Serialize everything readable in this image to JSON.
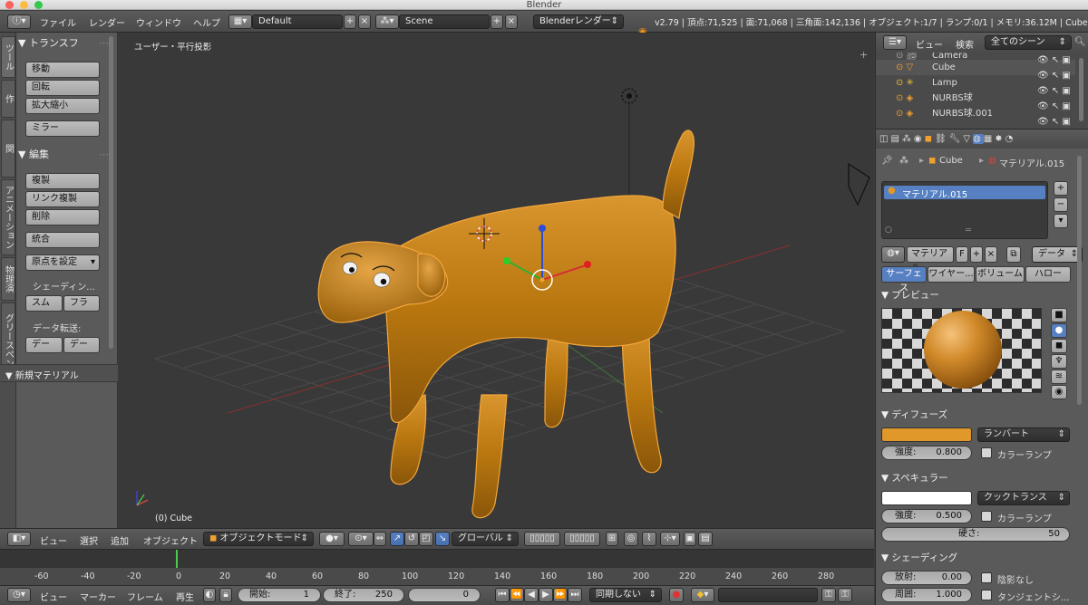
{
  "window": {
    "title": "Blender"
  },
  "info_bar": {
    "menus": [
      "ファイル",
      "レンダー",
      "ウィンドウ",
      "ヘルプ"
    ],
    "layout": "Default",
    "scene": "Scene",
    "engine": "Blenderレンダー",
    "stats": "v2.79 | 頂点:71,525 | 面:71,068 | 三角面:142,136 | オブジェクト:1/7 | ランプ:0/1 | メモリ:36.12M | Cube"
  },
  "tool_shelf": {
    "tabs": [
      "ツール",
      "作",
      "関",
      "アニメーション",
      "物理演",
      "グリースペン"
    ],
    "transform": {
      "header": "トランスフ",
      "buttons": [
        "移動",
        "回転",
        "拡大縮小",
        "ミラー"
      ]
    },
    "edit": {
      "header": "編集",
      "buttons": [
        "複製",
        "リンク複製",
        "削除",
        "統合"
      ],
      "origin": "原点を設定"
    },
    "shading": {
      "label": "シェーディン...",
      "smooth": "スム",
      "flat": "フラ"
    },
    "data_transfer": {
      "label": "データ転送:",
      "btn1": "デー",
      "btn2": "デー"
    },
    "operator": "新規マテリアル"
  },
  "viewport": {
    "view_label": "ユーザー・平行投影",
    "object_label": "(0) Cube",
    "body_color": "#c9851a"
  },
  "view3d_header": {
    "menus": [
      "ビュー",
      "選択",
      "追加",
      "オブジェクト"
    ],
    "mode": "オブジェクトモード",
    "orientation": "グローバル"
  },
  "timeline": {
    "ticks": [
      "-60",
      "-40",
      "-20",
      "0",
      "20",
      "40",
      "60",
      "80",
      "100",
      "120",
      "140",
      "160",
      "180",
      "200",
      "220",
      "240",
      "260",
      "280"
    ],
    "current_frame": 0,
    "menus": [
      "ビュー",
      "マーカー",
      "フレーム",
      "再生"
    ],
    "start_label": "開始:",
    "start": "1",
    "end_label": "終了:",
    "end": "250",
    "frame": "0",
    "sync": "同期しない"
  },
  "outliner": {
    "menus": [
      "ビュー",
      "検索"
    ],
    "scene_filter": "全てのシーン",
    "items": [
      "Camera",
      "Cube",
      "Lamp",
      "NURBS球",
      "NURBS球.001"
    ]
  },
  "properties": {
    "breadcrumb_object": "Cube",
    "breadcrumb_material": "マテリアル.015",
    "slot": "マテリアル.015",
    "material_name": "マテリアル",
    "fake_user": "F",
    "link": "データ",
    "tabs": [
      "サーフェス",
      "ワイヤー...",
      "ボリューム",
      "ハロー"
    ],
    "preview": {
      "header": "プレビュー"
    },
    "diffuse": {
      "header": "ディフューズ",
      "color": "#e0982a",
      "shader": "ランバート",
      "intensity_label": "強度:",
      "intensity": "0.800",
      "ramp": "カラーランプ"
    },
    "specular": {
      "header": "スペキュラー",
      "color": "#ffffff",
      "shader": "クックトランス",
      "intensity_label": "強度:",
      "intensity": "0.500",
      "ramp": "カラーランプ",
      "hardness_label": "硬さ:",
      "hardness": "50"
    },
    "shading": {
      "header": "シェーディング",
      "emit_label": "放射:",
      "emit": "0.00",
      "shadeless": "陰影なし",
      "ambient_label": "周囲:",
      "ambient": "1.000",
      "tangent": "タンジェントシ..."
    }
  }
}
